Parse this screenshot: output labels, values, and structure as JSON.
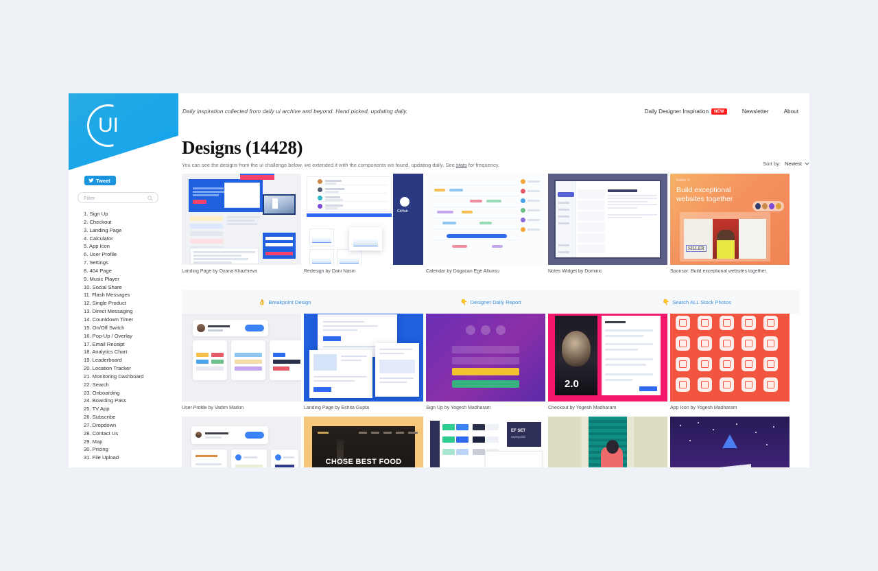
{
  "site": {
    "logo_text": "UI",
    "tagline": "Daily inspiration collected from daily ui archive and beyond. Hand picked, updating daily."
  },
  "topnav": {
    "items": [
      {
        "label": "Daily Designer Inspiration",
        "badge": "NEW"
      },
      {
        "label": "Newsletter",
        "badge": ""
      },
      {
        "label": "About",
        "badge": ""
      }
    ]
  },
  "sidebar": {
    "tweet_label": "Tweet",
    "filter_placeholder": "Filter",
    "filter_value": "",
    "items": [
      "1. Sign Up",
      "2. Checkout",
      "3. Landing Page",
      "4. Calculator",
      "5. App Icon",
      "6. User Profile",
      "7. Settings",
      "8. 404 Page",
      "9. Music Player",
      "10. Social Share",
      "11. Flash Messages",
      "12. Single Product",
      "13. Direct Messaging",
      "14. Countdown Timer",
      "15. On/Off Switch",
      "16. Pop-Up / Overlay",
      "17. Email Receipt",
      "18. Analytics Chart",
      "19. Leaderboard",
      "20. Location Tracker",
      "21. Monitoring Dashboard",
      "22. Search",
      "23. Onboarding",
      "24. Boarding Pass",
      "25. TV App",
      "26. Subscribe",
      "27. Dropdown",
      "28. Contact Us",
      "29. Map",
      "30. Pricing",
      "31. File Upload"
    ]
  },
  "main": {
    "title": "Designs (14428)",
    "subtitle_before": "You can see the designs from the ui challenge below, we extended it with the components we found, updating daily. See ",
    "subtitle_link": "stats",
    "subtitle_after": " for frequency.",
    "sort_label": "Sort by:",
    "sort_value": "Newest"
  },
  "promo": {
    "items": [
      {
        "emoji": "👌",
        "label": "Breakpoint Design"
      },
      {
        "emoji": "👇",
        "label": "Designer Daily Report"
      },
      {
        "emoji": "👇",
        "label": "Search ALL Stock Photos"
      }
    ]
  },
  "grid": {
    "row1": [
      {
        "caption": "Landing Page by Oxana Khazhieva"
      },
      {
        "caption": "Redesign by Dani Nasiri"
      },
      {
        "caption": "Calendar by Dogacan Ege Altunsu"
      },
      {
        "caption": "Notes Widget by Dominic"
      },
      {
        "caption": "Sponsor: Build exceptional websites together."
      }
    ],
    "row2": [
      {
        "caption": "User Profile by Vadim Markin"
      },
      {
        "caption": "Landing Page by Eshita Gupta"
      },
      {
        "caption": "Sign Up by Yogesh Madharam"
      },
      {
        "caption": "Checkout by Yogesh Madharam"
      },
      {
        "caption": "App Icon by Yogesh Madharam"
      }
    ],
    "row3": [
      {
        "caption": ""
      },
      {
        "caption": ""
      },
      {
        "caption": ""
      },
      {
        "caption": ""
      },
      {
        "caption": ""
      }
    ]
  },
  "thumbnails": {
    "sponsor": {
      "brand": "Editor X",
      "headline_line1": "Build exceptional",
      "headline_line2": "websites together",
      "inner_word": "SILLER"
    },
    "food": {
      "headline": "CHOSE BEST FOOD"
    },
    "styleguide": {
      "title": "EF SET",
      "subtitle": "Styleguide"
    },
    "checkout": {
      "big_number": "2.0"
    }
  },
  "colors": {
    "brand_blue": "#29abe2",
    "accent_red": "#ff1a1a",
    "link_blue": "#3b8fe0",
    "page_bg": "#eef1f5"
  }
}
